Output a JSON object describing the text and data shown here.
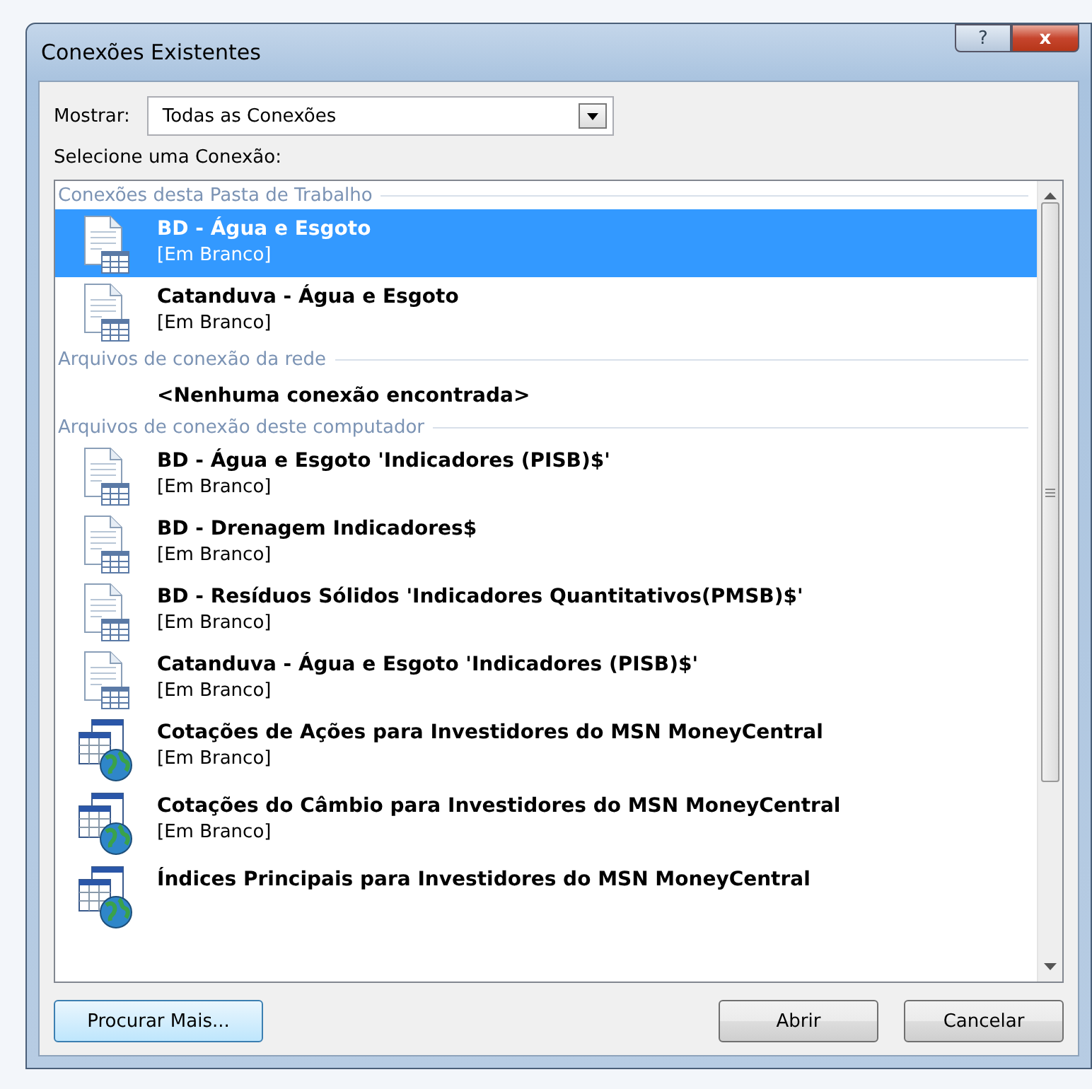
{
  "window": {
    "title": "Conexões Existentes",
    "help_button": "?",
    "close_button": "x"
  },
  "show_filter": {
    "label": "Mostrar:",
    "value": "Todas as Conexões"
  },
  "list_label": "Selecione uma Conexão:",
  "groups": [
    {
      "title": "Conexões desta Pasta de Trabalho",
      "items": [
        {
          "kind": "file",
          "name": "BD - Água e Esgoto",
          "description": "[Em Branco]",
          "selected": true
        },
        {
          "kind": "file",
          "name": "Catanduva - Água e Esgoto",
          "description": "[Em Branco]",
          "selected": false
        }
      ]
    },
    {
      "title": "Arquivos de conexão da rede",
      "items": [
        {
          "kind": "empty",
          "name": "<Nenhuma conexão encontrada>",
          "selected": false
        }
      ]
    },
    {
      "title": "Arquivos de conexão deste computador",
      "items": [
        {
          "kind": "file",
          "name": "BD - Água e Esgoto 'Indicadores (PISB)$'",
          "description": "[Em Branco]",
          "selected": false
        },
        {
          "kind": "file",
          "name": "BD - Drenagem Indicadores$",
          "description": "[Em Branco]",
          "selected": false
        },
        {
          "kind": "file",
          "name": "BD - Resíduos Sólidos 'Indicadores Quantitativos(PMSB)$'",
          "description": "[Em Branco]",
          "selected": false
        },
        {
          "kind": "file",
          "name": "Catanduva - Água e Esgoto 'Indicadores (PISB)$'",
          "description": "[Em Branco]",
          "selected": false
        },
        {
          "kind": "web",
          "name": "Cotações de Ações para Investidores do MSN MoneyCentral",
          "description": "[Em Branco]",
          "selected": false
        },
        {
          "kind": "web",
          "name": "Cotações do Câmbio para Investidores do MSN MoneyCentral",
          "description": "[Em Branco]",
          "selected": false
        },
        {
          "kind": "web",
          "name": "Índices Principais para Investidores do MSN MoneyCentral",
          "selected": false
        }
      ]
    }
  ],
  "buttons": {
    "browse": "Procurar Mais...",
    "open": "Abrir",
    "cancel": "Cancelar"
  }
}
